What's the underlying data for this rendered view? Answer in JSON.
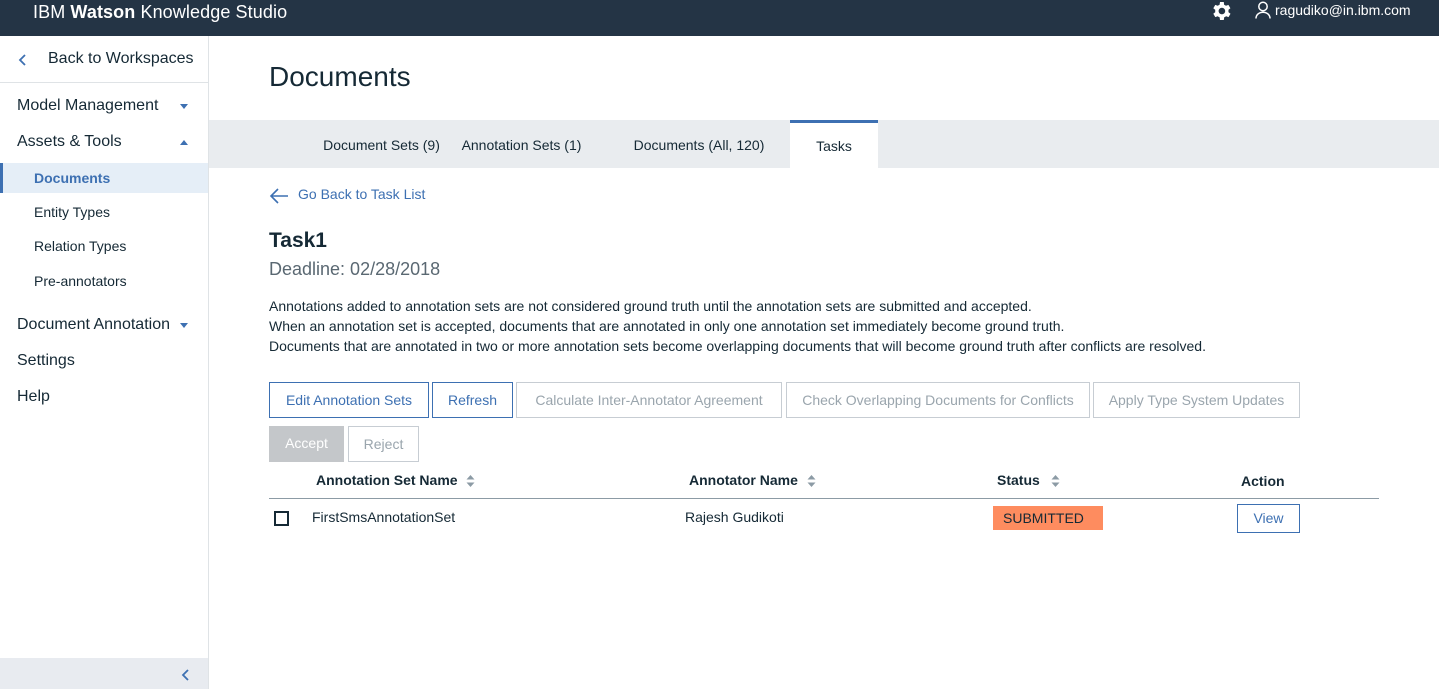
{
  "header": {
    "brand_prefix": "IBM",
    "brand_bold": "Watson",
    "brand_suffix": "Knowledge Studio",
    "user_email": "ragudiko@in.ibm.com",
    "settings_icon": "gear-icon",
    "user_icon": "user-icon"
  },
  "sidebar": {
    "back_label": "Back to Workspaces",
    "groups": [
      {
        "label": "Model Management",
        "expanded": false
      },
      {
        "label": "Assets & Tools",
        "expanded": true
      },
      {
        "label": "Document Annotation",
        "expanded": false
      },
      {
        "label": "Settings"
      },
      {
        "label": "Help"
      }
    ],
    "items": [
      {
        "label": "Documents",
        "active": true
      },
      {
        "label": "Entity Types"
      },
      {
        "label": "Relation Types"
      },
      {
        "label": "Pre-annotators"
      }
    ]
  },
  "main": {
    "title": "Documents",
    "tabs": [
      {
        "label": "Document Sets (9)"
      },
      {
        "label": "Annotation Sets (1)"
      },
      {
        "label": "Documents (All, 120)"
      },
      {
        "label": "Tasks",
        "active": true
      }
    ],
    "go_back_label": "Go Back to Task List",
    "task": {
      "name": "Task1",
      "deadline": "Deadline: 02/28/2018"
    },
    "info_lines": [
      "Annotations added to annotation sets are not considered ground truth until the annotation sets are submitted and accepted.",
      "When an annotation set is accepted, documents that are annotated in only one annotation set immediately become ground truth.",
      "Documents that are annotated in two or more annotation sets become overlapping documents that will become ground truth after conflicts are resolved."
    ],
    "buttons": {
      "edit_annotation_sets": "Edit Annotation Sets",
      "refresh": "Refresh",
      "calculate_iaa": "Calculate Inter-Annotator Agreement",
      "check_overlapping": "Check Overlapping Documents for Conflicts",
      "apply_type_system": "Apply Type System Updates",
      "accept": "Accept",
      "reject": "Reject"
    },
    "table": {
      "columns": [
        "Annotation Set Name",
        "Annotator Name",
        "Status",
        "Action"
      ],
      "rows": [
        {
          "annotation_set_name": "FirstSmsAnnotationSet",
          "annotator_name": "Rajesh Gudikoti",
          "status": "SUBMITTED",
          "action": "View"
        }
      ]
    }
  },
  "colors": {
    "topbar": "#243445",
    "accent": "#3d70b2",
    "status_submitted": "#fe8c5f",
    "tabbar": "#e9ecef"
  }
}
